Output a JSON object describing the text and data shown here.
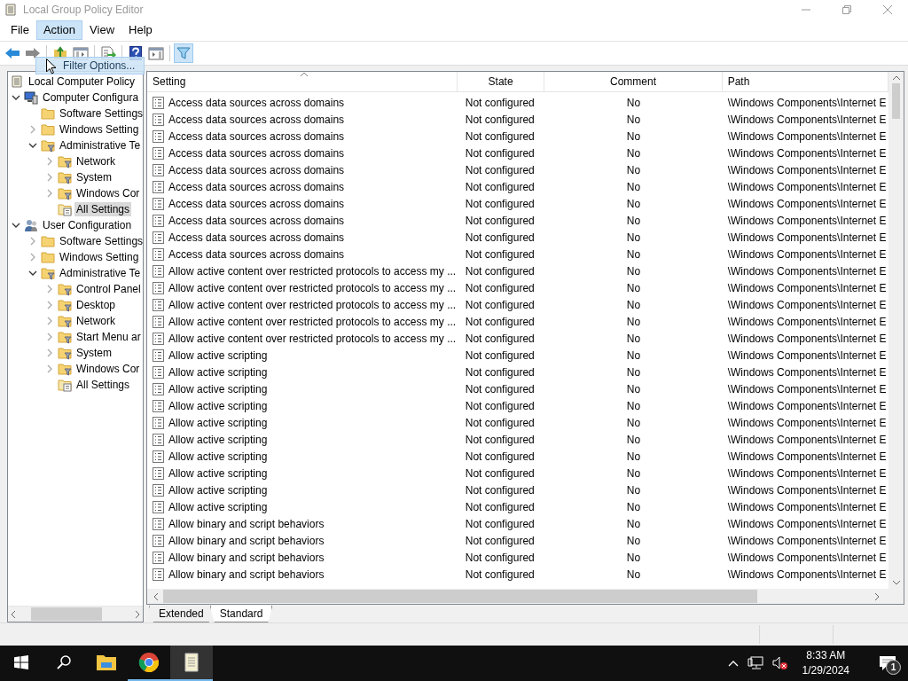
{
  "window": {
    "title": "Local Group Policy Editor"
  },
  "menu": [
    {
      "label": "File",
      "selected": false
    },
    {
      "label": "Action",
      "selected": true
    },
    {
      "label": "View",
      "selected": false
    },
    {
      "label": "Help",
      "selected": false
    }
  ],
  "toolbar": [
    {
      "kind": "back",
      "pressed": false
    },
    {
      "kind": "forward",
      "pressed": false
    },
    {
      "kind": "up",
      "pressed": false
    },
    {
      "kind": "tree",
      "pressed": false
    },
    {
      "kind": "export",
      "pressed": false
    },
    {
      "kind": "help",
      "pressed": false
    },
    {
      "kind": "panel",
      "pressed": false
    },
    {
      "kind": "filter",
      "pressed": true
    }
  ],
  "tooltip": {
    "text": "Filter Options..."
  },
  "tree": [
    {
      "label": "Local Computer Policy",
      "kind": "policy",
      "selected": false,
      "children": [
        {
          "label": "Computer Configura",
          "kind": "computer",
          "expanded": true,
          "selected": false,
          "children": [
            {
              "label": "Software Settings",
              "kind": "folder",
              "selected": false
            },
            {
              "label": "Windows Setting",
              "kind": "folder",
              "expanded": false,
              "selected": false
            },
            {
              "label": "Administrative Te",
              "kind": "admin",
              "expanded": true,
              "selected": false,
              "children": [
                {
                  "label": "Network",
                  "kind": "admin",
                  "expanded": false,
                  "selected": false
                },
                {
                  "label": "System",
                  "kind": "admin",
                  "expanded": false,
                  "selected": false
                },
                {
                  "label": "Windows Cor",
                  "kind": "admin",
                  "expanded": false,
                  "selected": false
                },
                {
                  "label": "All Settings",
                  "kind": "all",
                  "selected": true
                }
              ]
            }
          ]
        },
        {
          "label": "User Configuration",
          "kind": "user",
          "expanded": true,
          "selected": false,
          "children": [
            {
              "label": "Software Settings",
              "kind": "folder",
              "expanded": false,
              "selected": false
            },
            {
              "label": "Windows Setting",
              "kind": "folder",
              "expanded": false,
              "selected": false
            },
            {
              "label": "Administrative Te",
              "kind": "admin",
              "expanded": true,
              "selected": false,
              "children": [
                {
                  "label": "Control Panel",
                  "kind": "admin",
                  "expanded": false,
                  "selected": false
                },
                {
                  "label": "Desktop",
                  "kind": "admin",
                  "expanded": false,
                  "selected": false
                },
                {
                  "label": "Network",
                  "kind": "admin",
                  "expanded": false,
                  "selected": false
                },
                {
                  "label": "Start Menu ar",
                  "kind": "admin",
                  "expanded": false,
                  "selected": false
                },
                {
                  "label": "System",
                  "kind": "admin",
                  "expanded": false,
                  "selected": false
                },
                {
                  "label": "Windows Cor",
                  "kind": "admin",
                  "expanded": false,
                  "selected": false
                },
                {
                  "label": "All Settings",
                  "kind": "all",
                  "selected": false
                }
              ]
            }
          ]
        }
      ]
    }
  ],
  "table": {
    "columns": [
      "Setting",
      "State",
      "Comment",
      "Path"
    ],
    "rows": [
      {
        "setting": "Access data sources across domains",
        "state": "Not configured",
        "comment": "No",
        "path": "\\Windows Components\\Internet E"
      },
      {
        "setting": "Access data sources across domains",
        "state": "Not configured",
        "comment": "No",
        "path": "\\Windows Components\\Internet E"
      },
      {
        "setting": "Access data sources across domains",
        "state": "Not configured",
        "comment": "No",
        "path": "\\Windows Components\\Internet E"
      },
      {
        "setting": "Access data sources across domains",
        "state": "Not configured",
        "comment": "No",
        "path": "\\Windows Components\\Internet E"
      },
      {
        "setting": "Access data sources across domains",
        "state": "Not configured",
        "comment": "No",
        "path": "\\Windows Components\\Internet E"
      },
      {
        "setting": "Access data sources across domains",
        "state": "Not configured",
        "comment": "No",
        "path": "\\Windows Components\\Internet E"
      },
      {
        "setting": "Access data sources across domains",
        "state": "Not configured",
        "comment": "No",
        "path": "\\Windows Components\\Internet E"
      },
      {
        "setting": "Access data sources across domains",
        "state": "Not configured",
        "comment": "No",
        "path": "\\Windows Components\\Internet E"
      },
      {
        "setting": "Access data sources across domains",
        "state": "Not configured",
        "comment": "No",
        "path": "\\Windows Components\\Internet E"
      },
      {
        "setting": "Access data sources across domains",
        "state": "Not configured",
        "comment": "No",
        "path": "\\Windows Components\\Internet E"
      },
      {
        "setting": "Allow active content over restricted protocols to access my ...",
        "state": "Not configured",
        "comment": "No",
        "path": "\\Windows Components\\Internet E"
      },
      {
        "setting": "Allow active content over restricted protocols to access my ...",
        "state": "Not configured",
        "comment": "No",
        "path": "\\Windows Components\\Internet E"
      },
      {
        "setting": "Allow active content over restricted protocols to access my ...",
        "state": "Not configured",
        "comment": "No",
        "path": "\\Windows Components\\Internet E"
      },
      {
        "setting": "Allow active content over restricted protocols to access my ...",
        "state": "Not configured",
        "comment": "No",
        "path": "\\Windows Components\\Internet E"
      },
      {
        "setting": "Allow active content over restricted protocols to access my ...",
        "state": "Not configured",
        "comment": "No",
        "path": "\\Windows Components\\Internet E"
      },
      {
        "setting": "Allow active scripting",
        "state": "Not configured",
        "comment": "No",
        "path": "\\Windows Components\\Internet E"
      },
      {
        "setting": "Allow active scripting",
        "state": "Not configured",
        "comment": "No",
        "path": "\\Windows Components\\Internet E"
      },
      {
        "setting": "Allow active scripting",
        "state": "Not configured",
        "comment": "No",
        "path": "\\Windows Components\\Internet E"
      },
      {
        "setting": "Allow active scripting",
        "state": "Not configured",
        "comment": "No",
        "path": "\\Windows Components\\Internet E"
      },
      {
        "setting": "Allow active scripting",
        "state": "Not configured",
        "comment": "No",
        "path": "\\Windows Components\\Internet E"
      },
      {
        "setting": "Allow active scripting",
        "state": "Not configured",
        "comment": "No",
        "path": "\\Windows Components\\Internet E"
      },
      {
        "setting": "Allow active scripting",
        "state": "Not configured",
        "comment": "No",
        "path": "\\Windows Components\\Internet E"
      },
      {
        "setting": "Allow active scripting",
        "state": "Not configured",
        "comment": "No",
        "path": "\\Windows Components\\Internet E"
      },
      {
        "setting": "Allow active scripting",
        "state": "Not configured",
        "comment": "No",
        "path": "\\Windows Components\\Internet E"
      },
      {
        "setting": "Allow active scripting",
        "state": "Not configured",
        "comment": "No",
        "path": "\\Windows Components\\Internet E"
      },
      {
        "setting": "Allow binary and script behaviors",
        "state": "Not configured",
        "comment": "No",
        "path": "\\Windows Components\\Internet E"
      },
      {
        "setting": "Allow binary and script behaviors",
        "state": "Not configured",
        "comment": "No",
        "path": "\\Windows Components\\Internet E"
      },
      {
        "setting": "Allow binary and script behaviors",
        "state": "Not configured",
        "comment": "No",
        "path": "\\Windows Components\\Internet E"
      },
      {
        "setting": "Allow binary and script behaviors",
        "state": "Not configured",
        "comment": "No",
        "path": "\\Windows Components\\Internet E"
      }
    ]
  },
  "view_tabs": [
    {
      "label": "Extended",
      "selected": false
    },
    {
      "label": "Standard",
      "selected": true
    }
  ],
  "taskbar": {
    "apps": [
      {
        "kind": "explorer",
        "running": false,
        "active": false
      },
      {
        "kind": "browser",
        "running": true,
        "active": false
      },
      {
        "kind": "policy",
        "running": true,
        "active": true
      }
    ],
    "time": "8:33 AM",
    "date": "1/29/2024",
    "notifications": "1"
  }
}
